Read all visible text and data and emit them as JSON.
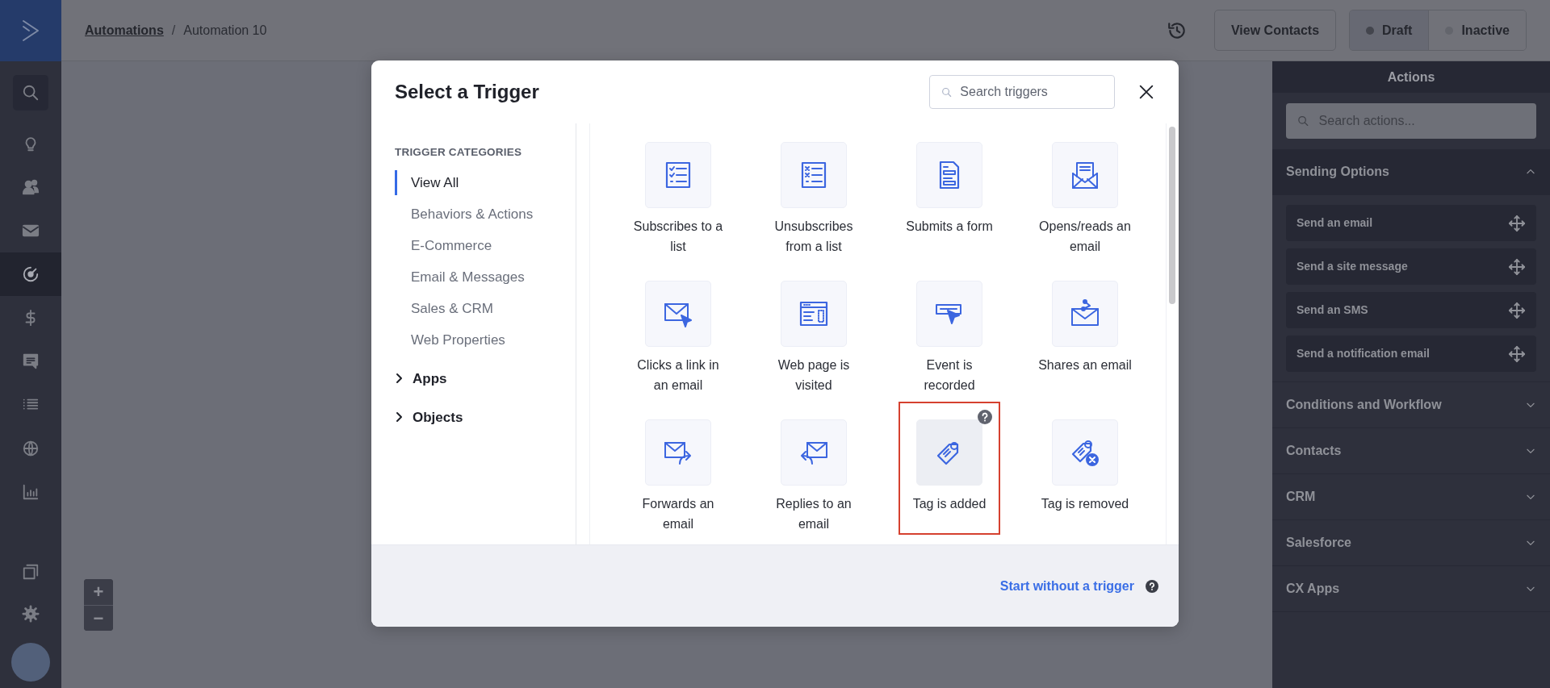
{
  "breadcrumb": {
    "parent": "Automations",
    "separator": "/",
    "current": "Automation 10"
  },
  "header_actions": {
    "view_contacts": "View Contacts",
    "status": [
      {
        "label": "Draft",
        "selected": true
      },
      {
        "label": "Inactive",
        "selected": false
      }
    ]
  },
  "sidebar": {
    "items": [
      {
        "selected": false
      },
      {
        "selected": false
      },
      {
        "selected": false
      },
      {
        "selected": true
      },
      {
        "selected": false
      },
      {
        "selected": false
      },
      {
        "selected": false
      },
      {
        "selected": false
      },
      {
        "selected": false
      }
    ]
  },
  "zoom_controls": {
    "zoom_in": "+",
    "zoom_out": "−"
  },
  "modal": {
    "title": "Select a Trigger",
    "search": {
      "placeholder": "Search triggers"
    },
    "categories_heading": "TRIGGER CATEGORIES",
    "categories": [
      {
        "label": "View All",
        "selected": true
      },
      {
        "label": "Behaviors & Actions",
        "selected": false
      },
      {
        "label": "E-Commerce",
        "selected": false
      },
      {
        "label": "Email & Messages",
        "selected": false
      },
      {
        "label": "Sales & CRM",
        "selected": false
      },
      {
        "label": "Web Properties",
        "selected": false
      }
    ],
    "groups": [
      {
        "label": "Apps",
        "expanded": false
      },
      {
        "label": "Objects",
        "expanded": false
      }
    ],
    "triggers": [
      {
        "label": "Subscribes to a list",
        "selected": false
      },
      {
        "label": "Unsubscribes from a list",
        "selected": false
      },
      {
        "label": "Submits a form",
        "selected": false
      },
      {
        "label": "Opens/reads an email",
        "selected": false
      },
      {
        "label": "Clicks a link in an email",
        "selected": false
      },
      {
        "label": "Web page is visited",
        "selected": false
      },
      {
        "label": "Event is recorded",
        "selected": false
      },
      {
        "label": "Shares an email",
        "selected": false
      },
      {
        "label": "Forwards an email",
        "selected": false
      },
      {
        "label": "Replies to an email",
        "selected": false
      },
      {
        "label": "Tag is added",
        "selected": true
      },
      {
        "label": "Tag is removed",
        "selected": false
      }
    ],
    "footer_link": "Start without a trigger"
  },
  "actions_panel": {
    "title": "Actions",
    "search": {
      "placeholder": "Search actions..."
    },
    "sections": [
      {
        "label": "Sending Options",
        "expanded": true,
        "items": [
          "Send an email",
          "Send a site message",
          "Send an SMS",
          "Send a notification email"
        ]
      },
      {
        "label": "Conditions and Workflow",
        "expanded": false
      },
      {
        "label": "Contacts",
        "expanded": false
      },
      {
        "label": "CRM",
        "expanded": false
      },
      {
        "label": "Salesforce",
        "expanded": false
      },
      {
        "label": "CX Apps",
        "expanded": false
      }
    ]
  }
}
